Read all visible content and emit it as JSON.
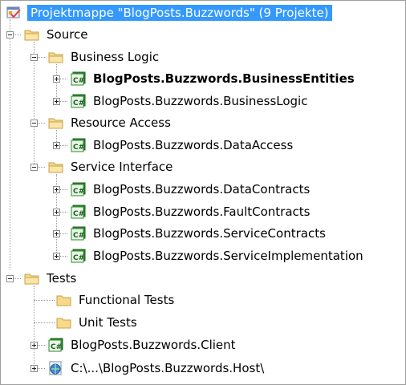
{
  "tree": {
    "root": {
      "label": "Projektmappe \"BlogPosts.Buzzwords\" (9 Projekte)",
      "icon": "solution-icon"
    },
    "items": [
      {
        "label": "Source",
        "icon": "folder-icon",
        "expander": "minus"
      },
      {
        "label": "Business Logic",
        "icon": "folder-icon",
        "expander": "minus"
      },
      {
        "label": "BlogPosts.Buzzwords.BusinessEntities",
        "icon": "csharp-project-icon",
        "expander": "plus",
        "bold": true
      },
      {
        "label": "BlogPosts.Buzzwords.BusinessLogic",
        "icon": "csharp-project-icon",
        "expander": "plus"
      },
      {
        "label": "Resource Access",
        "icon": "folder-icon",
        "expander": "minus"
      },
      {
        "label": "BlogPosts.Buzzwords.DataAccess",
        "icon": "csharp-project-icon",
        "expander": "plus"
      },
      {
        "label": "Service Interface",
        "icon": "folder-icon",
        "expander": "minus"
      },
      {
        "label": "BlogPosts.Buzzwords.DataContracts",
        "icon": "csharp-project-icon",
        "expander": "plus"
      },
      {
        "label": "BlogPosts.Buzzwords.FaultContracts",
        "icon": "csharp-project-icon",
        "expander": "plus"
      },
      {
        "label": "BlogPosts.Buzzwords.ServiceContracts",
        "icon": "csharp-project-icon",
        "expander": "plus"
      },
      {
        "label": "BlogPosts.Buzzwords.ServiceImplementation",
        "icon": "csharp-project-icon",
        "expander": "plus"
      },
      {
        "label": "Tests",
        "icon": "folder-icon",
        "expander": "minus"
      },
      {
        "label": "Functional Tests",
        "icon": "folder-icon"
      },
      {
        "label": "Unit Tests",
        "icon": "folder-icon"
      },
      {
        "label": "BlogPosts.Buzzwords.Client",
        "icon": "csharp-project-icon",
        "expander": "plus"
      },
      {
        "label": "C:\\...\\BlogPosts.Buzzwords.Host\\",
        "icon": "web-project-icon",
        "expander": "plus"
      }
    ]
  },
  "colors": {
    "selection": "#3399ff",
    "folder": "#f3d27a",
    "csharp": "#3c9a3c"
  }
}
